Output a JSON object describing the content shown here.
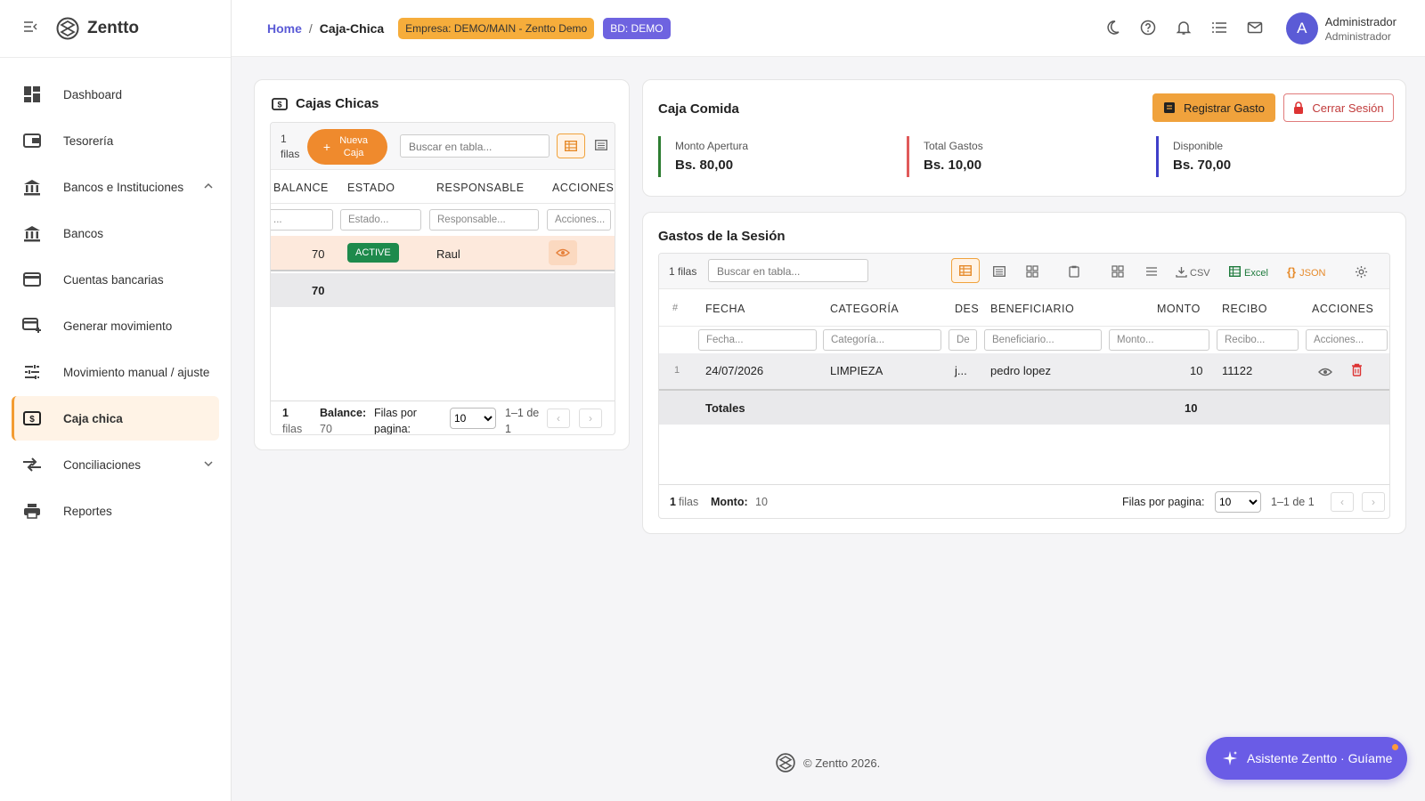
{
  "brand": {
    "name": "Zentto"
  },
  "sidebar": {
    "items": [
      {
        "label": "Dashboard"
      },
      {
        "label": "Tesorería"
      },
      {
        "label": "Bancos e Instituciones"
      },
      {
        "label": "Bancos"
      },
      {
        "label": "Cuentas bancarias"
      },
      {
        "label": "Generar movimiento"
      },
      {
        "label": "Movimiento manual / ajuste"
      },
      {
        "label": "Caja chica"
      },
      {
        "label": "Conciliaciones"
      },
      {
        "label": "Reportes"
      }
    ]
  },
  "header": {
    "breadcrumb_home": "Home",
    "breadcrumb_sep": "/",
    "breadcrumb_current": "Caja-Chica",
    "badge_empresa": "Empresa: DEMO/MAIN - Zentto Demo",
    "badge_bd": "BD: DEMO",
    "user_initial": "A",
    "user_name": "Administrador",
    "user_role": "Administrador"
  },
  "cajas": {
    "title": "Cajas Chicas",
    "rows_count": "1",
    "rows_label": "filas",
    "new_button": "Nueva Caja",
    "search_placeholder": "Buscar en tabla...",
    "columns": [
      "BALANCE",
      "ESTADO",
      "RESPONSABLE",
      "ACCIONES"
    ],
    "filters": [
      "...",
      "Estado...",
      "Responsable...",
      "Acciones..."
    ],
    "row": {
      "balance": "70",
      "estado": "ACTIVE",
      "responsable": "Raul"
    },
    "total_balance": "70",
    "footer_count": "1",
    "footer_rows_label": "filas",
    "footer_balance_label": "Balance:",
    "footer_balance_value": "70",
    "rows_per_page_label": "Filas por pagina:",
    "page_size": "10",
    "page_info": "1–1 de 1"
  },
  "session": {
    "title": "Caja Comida",
    "register_button": "Registrar Gasto",
    "close_button": "Cerrar Sesión",
    "stats": [
      {
        "label": "Monto Apertura",
        "value": "Bs. 80,00",
        "color": "#2e7d32"
      },
      {
        "label": "Total Gastos",
        "value": "Bs. 10,00",
        "color": "#e05a5a"
      },
      {
        "label": "Disponible",
        "value": "Bs. 70,00",
        "color": "#3f3fc9"
      }
    ]
  },
  "gastos": {
    "title": "Gastos de la Sesión",
    "rows_count_label": "1 filas",
    "search_placeholder": "Buscar en tabla...",
    "csv_label": "CSV",
    "excel_label": "Excel",
    "json_label": "JSON",
    "columns": [
      "#",
      "FECHA",
      "CATEGORÍA",
      "DESC",
      "BENEFICIARIO",
      "MONTO",
      "RECIBO",
      "ACCIONES"
    ],
    "filters": [
      "Fecha...",
      "Categoría...",
      "De",
      "Beneficiario...",
      "Monto...",
      "Recibo...",
      "Acciones..."
    ],
    "row": {
      "num": "1",
      "fecha": "24/07/2026",
      "categoria": "LIMPIEZA",
      "desc": "j...",
      "beneficiario": "pedro lopez",
      "monto": "10",
      "recibo": "11122"
    },
    "totals_label": "Totales",
    "totals_monto": "10",
    "footer_count": "1",
    "footer_rows_label": "filas",
    "footer_monto_label": "Monto:",
    "footer_monto_value": "10",
    "rows_per_page_label": "Filas por pagina:",
    "page_size": "10",
    "page_info": "1–1 de 1"
  },
  "footer": {
    "copyright": "© Zentto 2026."
  },
  "assistant": {
    "label": "Asistente Zentto · Guíame"
  },
  "colors": {
    "accent": "#f0a23c",
    "primary": "#5b5bd6",
    "active_badge": "#1e8a4c",
    "danger": "#d33"
  }
}
